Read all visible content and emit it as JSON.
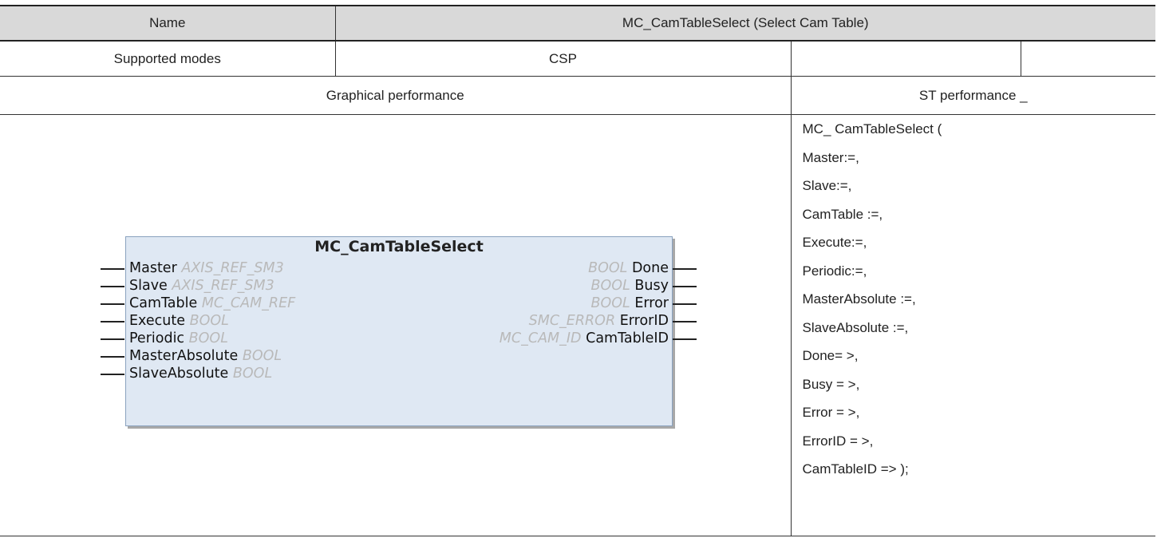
{
  "header": {
    "name_label": "Name",
    "name_value": "MC_CamTableSelect (Select Cam Table)"
  },
  "modes": {
    "label": "Supported modes",
    "value": "CSP"
  },
  "performance": {
    "graphical_label": "Graphical performance",
    "st_label": "ST performance _"
  },
  "block": {
    "title": "MC_CamTableSelect",
    "inputs": [
      {
        "name": "Master",
        "type": "AXIS_REF_SM3"
      },
      {
        "name": "Slave",
        "type": "AXIS_REF_SM3"
      },
      {
        "name": "CamTable",
        "type": "MC_CAM_REF"
      },
      {
        "name": "Execute",
        "type": "BOOL"
      },
      {
        "name": "Periodic",
        "type": "BOOL"
      },
      {
        "name": "MasterAbsolute",
        "type": "BOOL"
      },
      {
        "name": "SlaveAbsolute",
        "type": "BOOL"
      }
    ],
    "outputs": [
      {
        "name": "Done",
        "type": "BOOL"
      },
      {
        "name": "Busy",
        "type": "BOOL"
      },
      {
        "name": "Error",
        "type": "BOOL"
      },
      {
        "name": "ErrorID",
        "type": "SMC_ERROR"
      },
      {
        "name": "CamTableID",
        "type": "MC_CAM_ID"
      }
    ]
  },
  "st_code": [
    "MC_ CamTableSelect (",
    "Master:=,",
    "Slave:=,",
    "CamTable :=,",
    "Execute:=,",
    "Periodic:=,",
    "MasterAbsolute :=,",
    "SlaveAbsolute :=,",
    "Done= >,",
    "Busy = >,",
    "Error = >,",
    "ErrorID = >,",
    "CamTableID => );"
  ]
}
